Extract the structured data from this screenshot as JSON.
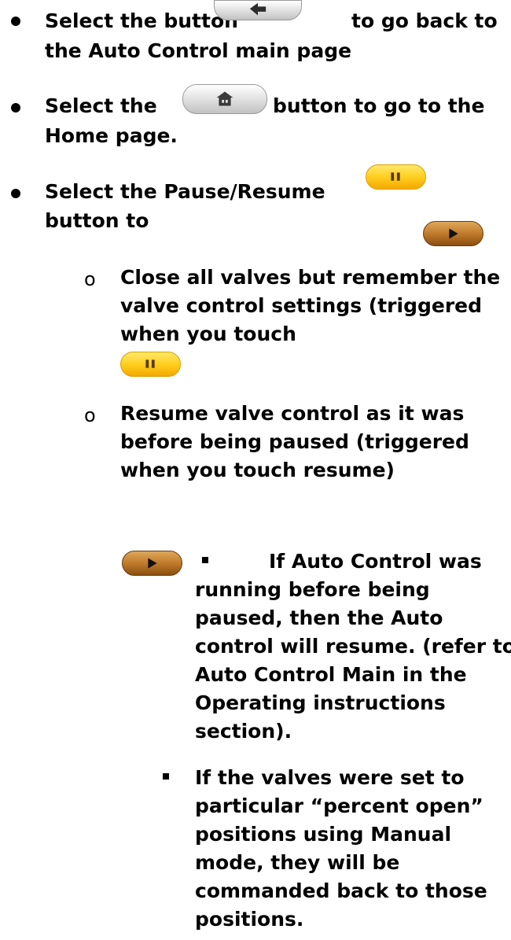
{
  "bullets": [
    {
      "line1_before": "Select the button",
      "line1_after": "to go back to",
      "line2": "the Auto Control main page",
      "icon": "back-arrow-icon"
    },
    {
      "line1_before": "Select the",
      "line1_after": "button to go to the",
      "line2": "Home page.",
      "icon": "home-icon"
    },
    {
      "line1": "Select the Pause/Resume",
      "line2": "button to",
      "icons": [
        "pause-icon",
        "play-icon"
      ]
    }
  ],
  "sub_items": [
    {
      "marker": "o",
      "lines": [
        "Close all valves but remember the",
        "valve control settings (triggered",
        "when you touch"
      ],
      "icon": "pause-icon"
    },
    {
      "marker": "o",
      "lines": [
        "Resume valve control as it was",
        "before being paused (triggered",
        "when you touch resume)"
      ]
    }
  ],
  "sub_sub_items": [
    {
      "icon": "play-icon",
      "lines": [
        "If Auto Control was",
        "running before being",
        "paused, then the Auto",
        "control will resume. (refer to",
        "Auto Control Main in the",
        "Operating instructions",
        "section)."
      ]
    },
    {
      "lines": [
        "If the valves were set to",
        "particular “percent open”",
        "positions using Manual",
        "mode, they will be",
        "commanded back to those",
        "positions."
      ]
    }
  ],
  "colors": {
    "text": "#000000",
    "pause_button": "#ffcf20",
    "play_button": "#c07a2c",
    "nav_button": "#d8d8d8"
  }
}
